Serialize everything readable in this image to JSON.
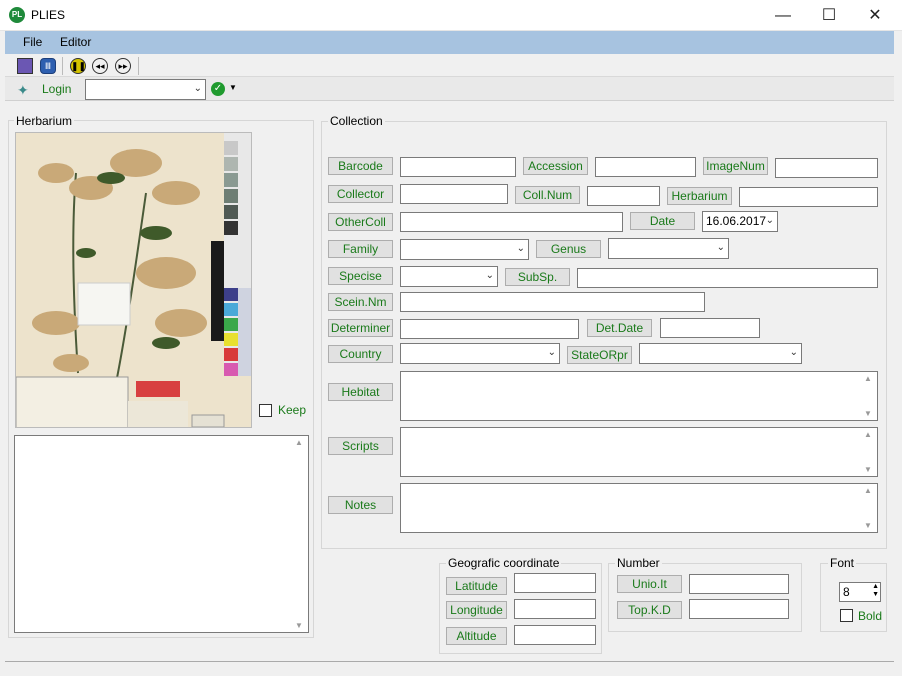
{
  "window": {
    "title": "PLIES",
    "app_icon": "PL",
    "minimize": "—",
    "maximize": "☐",
    "close": "✕"
  },
  "menu": {
    "file": "File",
    "editor": "Editor"
  },
  "toolbar": {
    "login": "Login",
    "combo_value": ""
  },
  "herbarium": {
    "group": "Herbarium",
    "keep": "Keep"
  },
  "collection": {
    "group": "Collection",
    "barcode": "Barcode",
    "accession": "Accession",
    "imagenum": "ImageNum",
    "collector": "Collector",
    "collnum": "Coll.Num",
    "herbarium": "Herbarium",
    "othercoll": "OtherColl",
    "date": "Date",
    "date_value": "16.06.2017",
    "family": "Family",
    "genus": "Genus",
    "specise": "Specise",
    "subsp": "SubSp.",
    "sceinnm": "Scein.Nm",
    "determiner": "Determiner",
    "detdate": "Det.Date",
    "country": "Country",
    "stateorpr": "StateORpr",
    "hebitat": "Hebitat",
    "scripts": "Scripts",
    "notes": "Notes"
  },
  "geo": {
    "group": "Geografic coordinate",
    "latitude": "Latitude",
    "longitude": "Longitude",
    "altitude": "Altitude"
  },
  "number": {
    "group": "Number",
    "uniolt": "Unio.It",
    "topkd": "Top.K.D"
  },
  "font": {
    "group": "Font",
    "size": "8",
    "bold": "Bold"
  },
  "colors": {
    "menubar": "#a7c3e0",
    "button_text": "#1a7a1a"
  }
}
